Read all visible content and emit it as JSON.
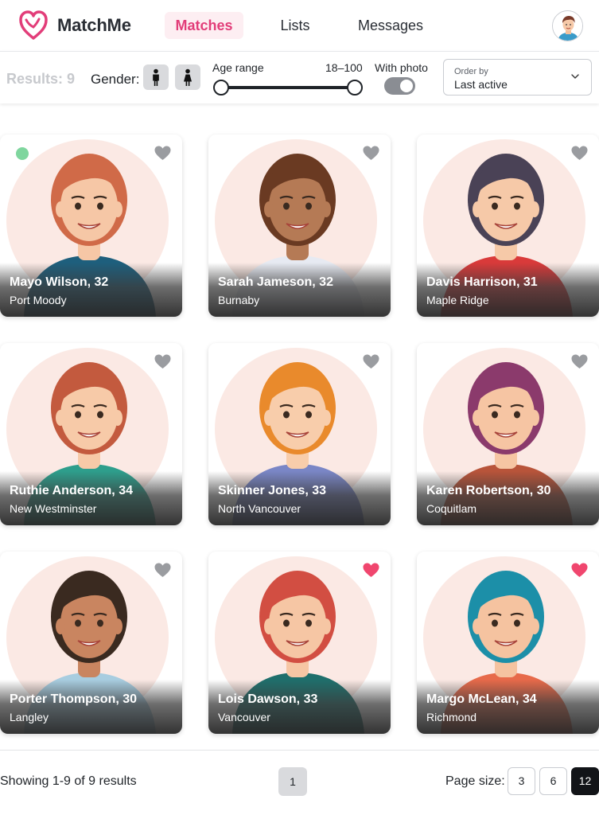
{
  "app": {
    "brand": "MatchMe"
  },
  "nav": {
    "tabs": [
      {
        "label": "Matches",
        "active": true
      },
      {
        "label": "Lists",
        "active": false
      },
      {
        "label": "Messages",
        "active": false
      }
    ]
  },
  "filters": {
    "results_label": "Results: 9",
    "gender_label": "Gender:",
    "age_label": "Age range",
    "age_value": "18–100",
    "age_min": 18,
    "age_max": 100,
    "photo_label": "With photo",
    "photo_on": true,
    "order_caption": "Order by",
    "order_value": "Last active"
  },
  "profiles": [
    {
      "name": "Mayo Wilson, 32",
      "city": "Port Moody",
      "liked": false,
      "online": true,
      "skin": "#f6c7a6",
      "hair": "#d06a48",
      "shirt": "#1e5f7d"
    },
    {
      "name": "Sarah Jameson, 32",
      "city": "Burnaby",
      "liked": false,
      "online": false,
      "skin": "#b57a55",
      "hair": "#6a3a22",
      "shirt": "#e7eaf2"
    },
    {
      "name": "Davis Harrison, 31",
      "city": "Maple Ridge",
      "liked": false,
      "online": false,
      "skin": "#f6c9a8",
      "hair": "#4a4256",
      "shirt": "#d93a3a"
    },
    {
      "name": "Ruthie Anderson, 34",
      "city": "New Westminster",
      "liked": false,
      "online": false,
      "skin": "#f7caa8",
      "hair": "#c35a3e",
      "shirt": "#2e9e8c"
    },
    {
      "name": "Skinner Jones, 33",
      "city": "North Vancouver",
      "liked": false,
      "online": false,
      "skin": "#f8cdab",
      "hair": "#e98a2c",
      "shirt": "#7a86c6"
    },
    {
      "name": "Karen Robertson, 30",
      "city": "Coquitlam",
      "liked": false,
      "online": false,
      "skin": "#f6c5a3",
      "hair": "#8b3a6c",
      "shirt": "#b8543a"
    },
    {
      "name": "Porter Thompson, 30",
      "city": "Langley",
      "liked": false,
      "online": false,
      "skin": "#c98560",
      "hair": "#3a2a20",
      "shirt": "#a8cde0"
    },
    {
      "name": "Lois Dawson, 33",
      "city": "Vancouver",
      "liked": true,
      "online": false,
      "skin": "#f6c6a4",
      "hair": "#d24e42",
      "shirt": "#1f6f6c"
    },
    {
      "name": "Margo McLean, 34",
      "city": "Richmond",
      "liked": true,
      "online": false,
      "skin": "#f5c3a0",
      "hair": "#1c8fa8",
      "shirt": "#e76a4a"
    }
  ],
  "colors": {
    "accent": "#e23d79",
    "liked_heart": "#f0466e",
    "unliked_heart": "#9a9ca0",
    "online": "#7fd69e",
    "portrait_bg": "#fbe9e4"
  },
  "footer": {
    "showing": "Showing 1-9 of 9 results",
    "pages": [
      "1"
    ],
    "page_size_label": "Page size:",
    "page_sizes": [
      "3",
      "6",
      "12"
    ],
    "selected_page_size": "12"
  }
}
